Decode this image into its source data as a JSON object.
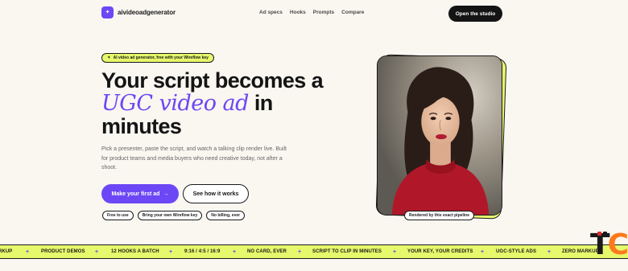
{
  "brand": {
    "name": "aivideoadgenerator",
    "icon": "sparkle-icon",
    "icon_glyph": "✦"
  },
  "nav": {
    "links": [
      "Ad specs",
      "Hooks",
      "Prompts",
      "Compare"
    ],
    "cta": "Open the studio"
  },
  "hero": {
    "pill": "AI video ad generator, free with your Wireflow key",
    "pill_icon": "✦",
    "headline_part1": "Your script becomes a",
    "headline_accent": "UGC video ad",
    "headline_part2": "in",
    "headline_part3": "minutes",
    "sub": "Pick a presenter, paste the script, and watch a talking clip render live. Built for product teams and media buyers who need creative today, not after a shoot.",
    "primary_cta": "Make your first ad",
    "primary_arrow": "→",
    "secondary_cta": "See how it works",
    "chips": [
      "Free to use",
      "Bring your own Wireflow key",
      "No billing, ever"
    ],
    "photo_caption": "Rendered by this exact pipeline"
  },
  "ticker": {
    "items": [
      "RKUP",
      "PRODUCT DEMOS",
      "12 HOOKS A BATCH",
      "9:16 / 4:5 / 16:9",
      "NO CARD, EVER",
      "SCRIPT TO CLIP IN MINUTES",
      "YOUR KEY, YOUR CREDITS",
      "UGC-STYLE ADS",
      "ZERO MARKUP"
    ],
    "separator": "+"
  },
  "colors": {
    "accent": "#6c47f5",
    "lime": "#e6f86b",
    "dark": "#141414",
    "bg": "#faf7f1"
  },
  "watermark": {
    "text_t": "T",
    "text_c": "C"
  }
}
